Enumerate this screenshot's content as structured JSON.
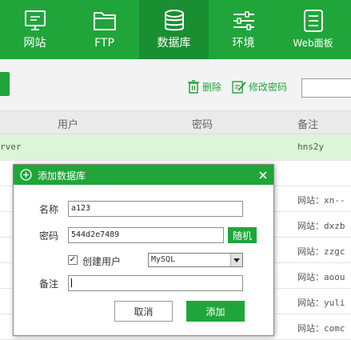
{
  "nav": {
    "items": [
      {
        "label": "网站",
        "icon": "monitor-icon"
      },
      {
        "label": "FTP",
        "icon": "folder-icon"
      },
      {
        "label": "数据库",
        "icon": "database-icon"
      },
      {
        "label": "环境",
        "icon": "sliders-icon"
      },
      {
        "label": "Web面板",
        "icon": "list-icon"
      }
    ],
    "active": "数据库"
  },
  "toolbar": {
    "delete_label": "删除",
    "change_password_label": "修改密码",
    "search_value": ""
  },
  "table": {
    "columns": [
      "用户",
      "密码",
      "备注"
    ],
    "rows": [
      {
        "user": "rver",
        "note": "hns2y"
      },
      {
        "note": "网站：xn--"
      },
      {
        "note": "网站：dxzb"
      },
      {
        "note": "网站：zzgc"
      },
      {
        "note": "网站：aoou"
      },
      {
        "note": "网站：yuli"
      },
      {
        "note": "网站：comc"
      }
    ]
  },
  "dialog": {
    "title": "添加数据库",
    "name_label": "名称",
    "name_value": "a123",
    "password_label": "密码",
    "password_value": "544d2e7489",
    "random_label": "随机",
    "create_user_label": "创建用户",
    "create_user_checked": true,
    "db_type_value": "MySQL",
    "note_label": "备注",
    "note_value": "",
    "cancel_label": "取消",
    "add_label": "添加"
  },
  "colors": {
    "brand_green": "#20a53a",
    "active_nav": "#1a8f31",
    "selected_row": "#dcf5d8"
  }
}
